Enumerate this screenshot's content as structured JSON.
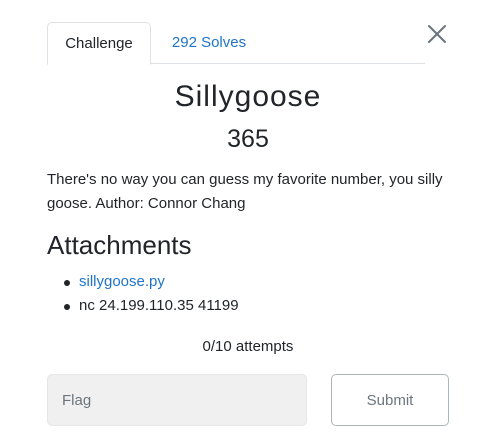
{
  "tabs": {
    "challenge_label": "Challenge",
    "solves_label": "292 Solves"
  },
  "challenge": {
    "name": "Sillygoose",
    "points": "365",
    "description": "There's no way you can guess my favorite number, you silly goose. Author: Connor Chang"
  },
  "attachments": {
    "heading": "Attachments",
    "items": [
      {
        "text": "sillygoose.py",
        "type": "link"
      },
      {
        "text": "nc 24.199.110.35 41199",
        "type": "text"
      }
    ]
  },
  "attempts": "0/10 attempts",
  "form": {
    "flag_placeholder": "Flag",
    "flag_value": "",
    "submit_label": "Submit"
  },
  "icons": {
    "close": "close-icon"
  },
  "colors": {
    "link": "#1f74c8",
    "text": "#212529",
    "input_bg": "#f0f0f0",
    "muted": "#6c757d"
  }
}
